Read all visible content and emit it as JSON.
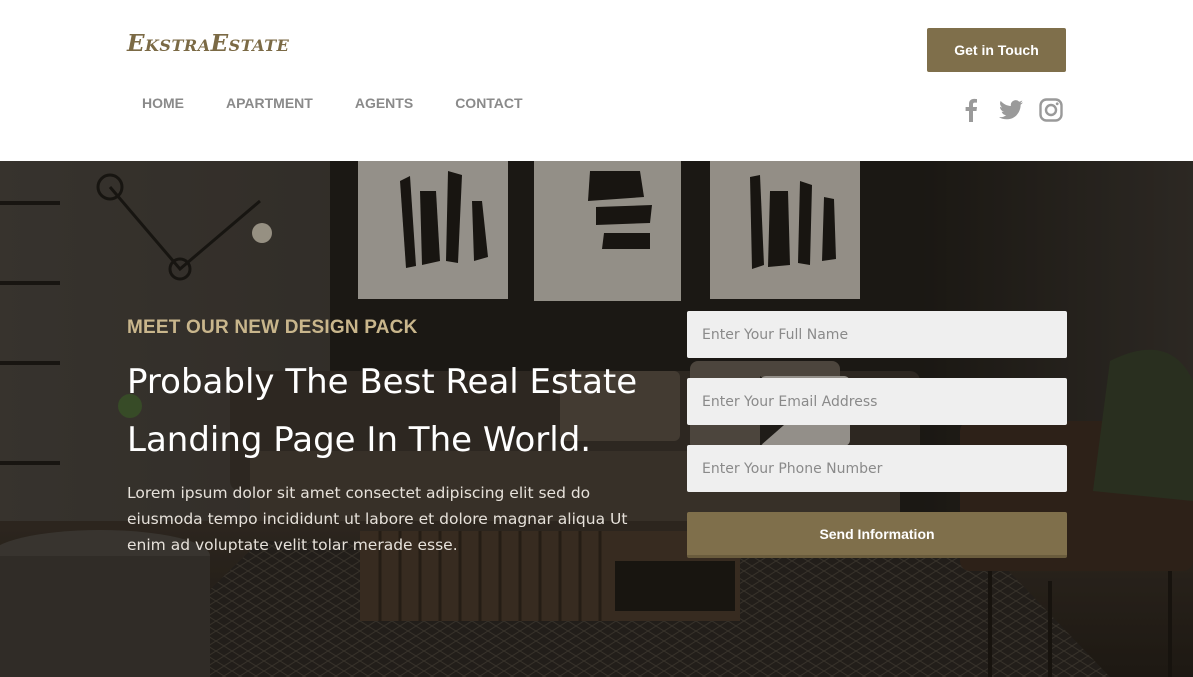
{
  "brand": {
    "logo_text": "EkstraEstate",
    "accent": "#7f6f4b"
  },
  "nav": {
    "items": [
      {
        "label": "HOME"
      },
      {
        "label": "APARTMENT"
      },
      {
        "label": "AGENTS"
      },
      {
        "label": "CONTACT"
      }
    ]
  },
  "header": {
    "cta_label": "Get in Touch",
    "social": [
      "facebook-icon",
      "twitter-icon",
      "instagram-icon"
    ]
  },
  "hero": {
    "eyebrow": "MEET OUR NEW DESIGN PACK",
    "headline": "Probably The Best Real Estate Landing Page In The World.",
    "lede": "Lorem ipsum dolor sit amet consectet adipiscing elit sed do eiusmoda tempo incididunt ut labore et dolore magnar aliqua Ut enim ad voluptate velit tolar merade esse."
  },
  "form": {
    "name_placeholder": "Enter Your Full Name",
    "email_placeholder": "Enter Your Email Address",
    "phone_placeholder": "Enter Your Phone Number",
    "submit_label": "Send Information"
  }
}
